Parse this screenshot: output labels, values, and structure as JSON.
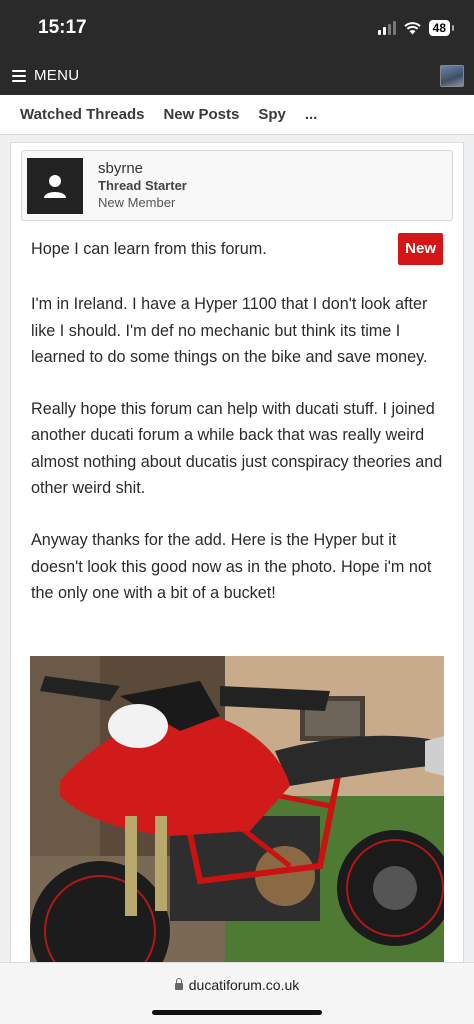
{
  "status": {
    "time": "15:17",
    "battery": "48"
  },
  "nav": {
    "menu_label": "MENU"
  },
  "tabs": [
    "Watched Threads",
    "New Posts",
    "Spy",
    "..."
  ],
  "post": {
    "author": "sbyrne",
    "role": "Thread Starter",
    "rank": "New Member",
    "title_line": "Hope I can learn from this forum.",
    "badge": "New",
    "paragraphs": [
      "I'm in Ireland. I have a Hyper 1100 that I don't look after like I should. I'm def no mechanic but think its time I learned to do some things on the bike and save money.",
      "Really hope this forum can help with ducati stuff. I joined another ducati forum a while back that was really weird almost nothing about ducatis just conspiracy theories and other weird shit.",
      "Anyway thanks for the add. Here is the Hyper but it doesn't look this good now as in the photo. Hope i'm not the only one with a bit of a bucket!"
    ]
  },
  "browser": {
    "url": "ducatiforum.co.uk"
  }
}
